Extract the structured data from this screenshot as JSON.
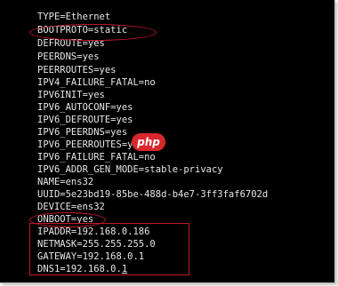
{
  "terminal": {
    "lines": [
      "TYPE=Ethernet",
      "BOOTPROTO=static",
      "DEFROUTE=yes",
      "PEERDNS=yes",
      "PEERROUTES=yes",
      "IPV4_FAILURE_FATAL=no",
      "IPV6INIT=yes",
      "IPV6_AUTOCONF=yes",
      "IPV6_DEFROUTE=yes",
      "IPV6_PEERDNS=yes",
      "IPV6_PEERROUTES=yes",
      "IPV6_FAILURE_FATAL=no",
      "IPV6_ADDR_GEN_MODE=stable-privacy",
      "NAME=ens32",
      "UUID=5e23bd19-85be-488d-b4e7-3ff3faf6702d",
      "DEVICE=ens32",
      "ONBOOT=yes",
      "IPADDR=192.168.0.186",
      "NETMASK=255.255.255.0",
      "GATEWAY=192.168.0.1"
    ],
    "last_line_prefix": "DNS1=192.168.0.",
    "last_line_cursor_char": "1"
  },
  "watermark": {
    "text": "php",
    "color": "#d8282c"
  },
  "annotation_color": "#c0182c"
}
